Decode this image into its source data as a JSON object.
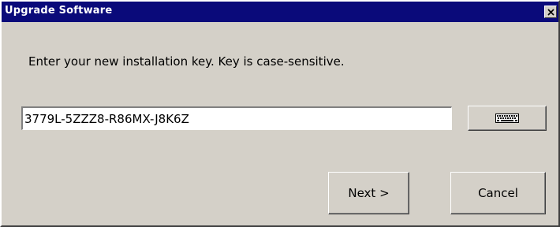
{
  "window": {
    "title": "Upgrade Software",
    "close_icon": "close-icon"
  },
  "dialog": {
    "instruction": "Enter your new installation key. Key is case-sensitive.",
    "key_input_value": "3779L-5ZZZ8-R86MX-J8K6Z",
    "keyboard_icon": "keyboard-icon"
  },
  "buttons": {
    "next_label": "Next >",
    "cancel_label": "Cancel"
  },
  "colors": {
    "titlebar": "#0a0a7a",
    "dialog_background": "#d4d0c8"
  }
}
